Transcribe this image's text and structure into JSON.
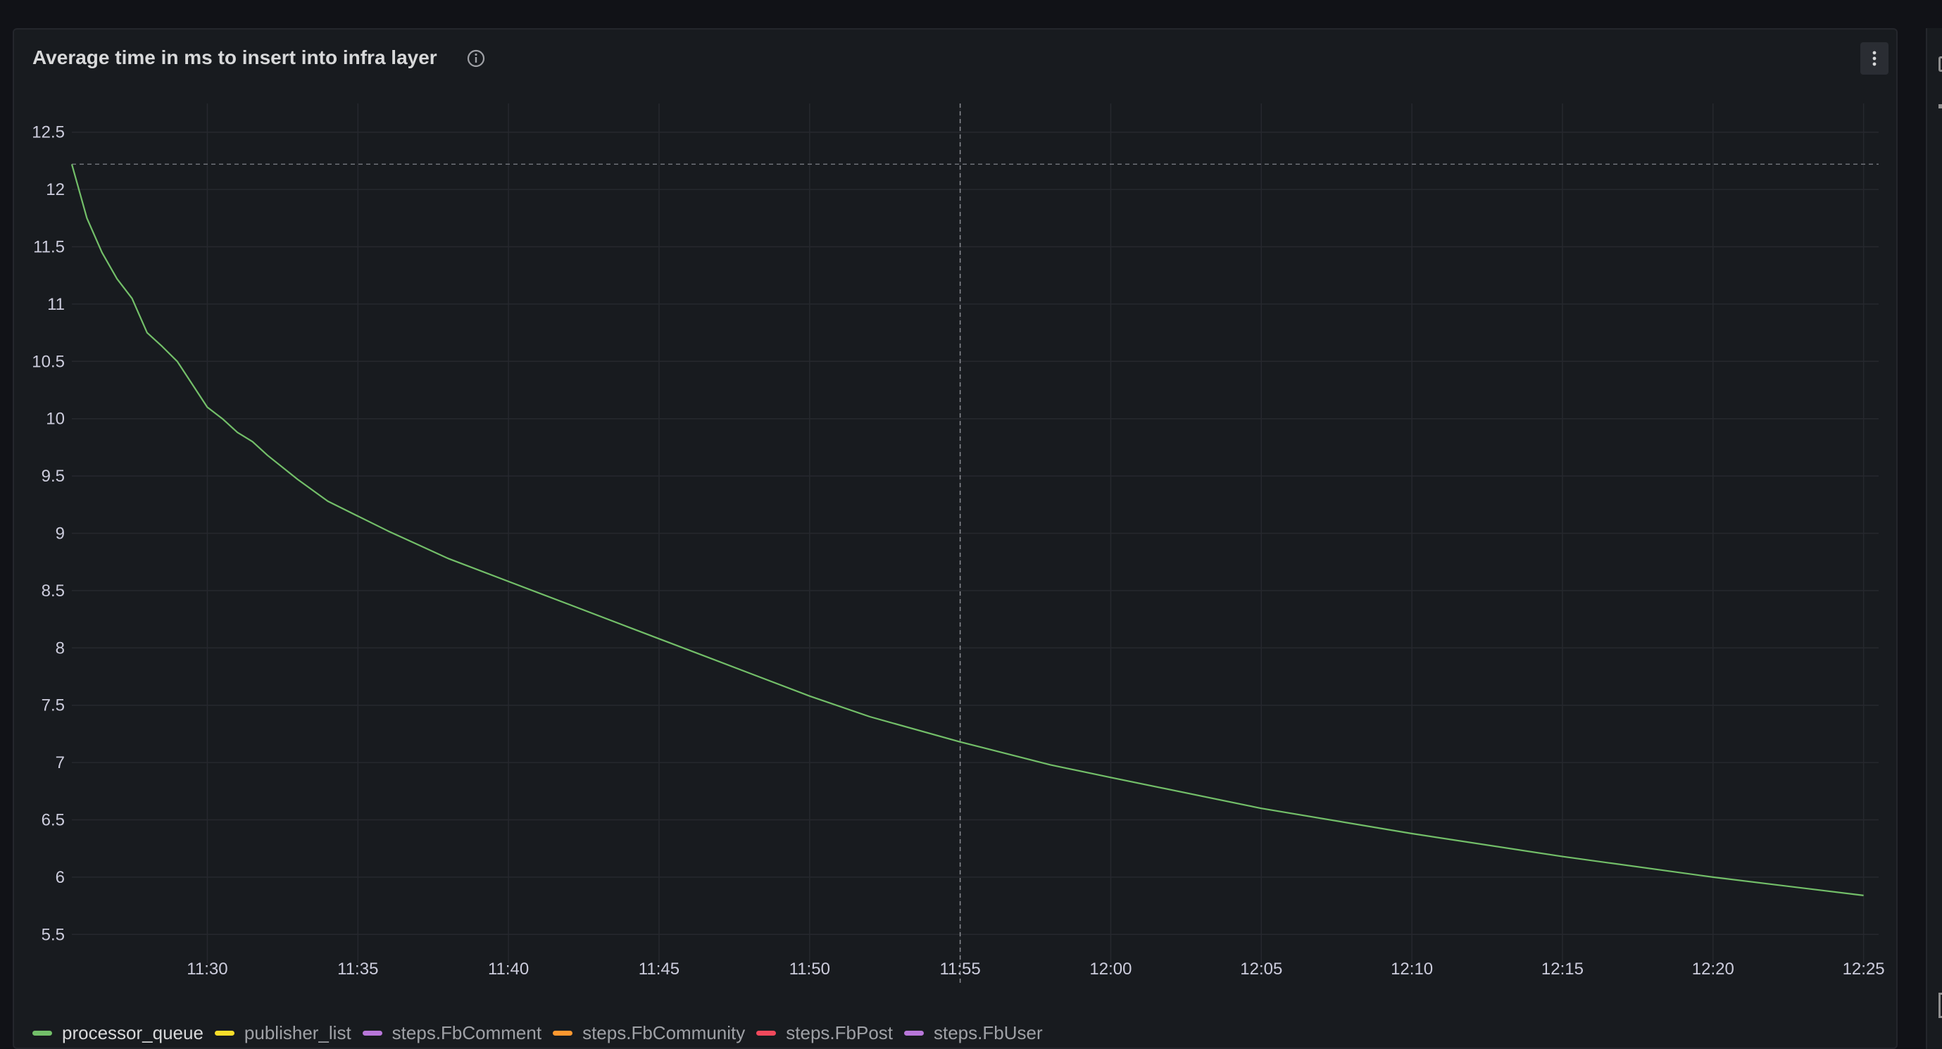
{
  "panel": {
    "title": "Average time in ms to insert into infra layer",
    "info_icon": "info-icon",
    "menu_icon": "kebab-menu-icon"
  },
  "colors": {
    "background": "#111217",
    "panel": "#181b1f",
    "grid": "#26282e",
    "series_line": "#73bf69",
    "muted_text": "#9fa1a6"
  },
  "chart_data": {
    "type": "line",
    "title": "Average time in ms to insert into infra layer",
    "xlabel": "",
    "ylabel": "",
    "x_tick_labels": [
      "11:30",
      "11:35",
      "11:40",
      "11:45",
      "11:50",
      "11:55",
      "12:00",
      "12:05",
      "12:10",
      "12:15",
      "12:20",
      "12:25"
    ],
    "y_tick_labels": [
      "5.5",
      "6",
      "6.5",
      "7",
      "7.5",
      "8",
      "8.5",
      "9",
      "9.5",
      "10",
      "10.5",
      "11",
      "11.5",
      "12",
      "12.5"
    ],
    "xlim": [
      "11:25:30",
      "12:25:30"
    ],
    "ylim": [
      5.25,
      12.75
    ],
    "grid": true,
    "legend_position": "bottom-left",
    "series": [
      {
        "name": "processor_queue",
        "color": "#73bf69",
        "x": [
          "11:25:30",
          "11:26:00",
          "11:26:30",
          "11:27:00",
          "11:27:30",
          "11:28:00",
          "11:28:30",
          "11:29:00",
          "11:29:30",
          "11:30:00",
          "11:30:30",
          "11:31:00",
          "11:31:30",
          "11:32:00",
          "11:33:00",
          "11:34:00",
          "11:35:00",
          "11:36:00",
          "11:37:00",
          "11:38:00",
          "11:40:00",
          "11:42:00",
          "11:45:00",
          "11:48:00",
          "11:50:00",
          "11:52:00",
          "11:55:00",
          "11:58:00",
          "12:00:00",
          "12:05:00",
          "12:10:00",
          "12:15:00",
          "12:20:00",
          "12:25:00"
        ],
        "values": [
          12.22,
          11.75,
          11.45,
          11.22,
          11.05,
          10.75,
          10.63,
          10.5,
          10.3,
          10.1,
          10.0,
          9.88,
          9.8,
          9.68,
          9.47,
          9.28,
          9.15,
          9.02,
          8.9,
          8.78,
          8.58,
          8.38,
          8.08,
          7.78,
          7.58,
          7.4,
          7.18,
          6.98,
          6.87,
          6.6,
          6.38,
          6.18,
          6.0,
          5.84
        ]
      }
    ],
    "hidden_series": [
      {
        "name": "publisher_list",
        "color": "#fade2a"
      },
      {
        "name": "steps.FbComment",
        "color": "#b877d9"
      },
      {
        "name": "steps.FbCommunity",
        "color": "#ff9830"
      },
      {
        "name": "steps.FbPost",
        "color": "#f2495c"
      },
      {
        "name": "steps.FbUser",
        "color": "#b877d9"
      }
    ],
    "reference_lines": {
      "horizontal_value": 12.22,
      "vertical_time": "11:55:00"
    }
  }
}
